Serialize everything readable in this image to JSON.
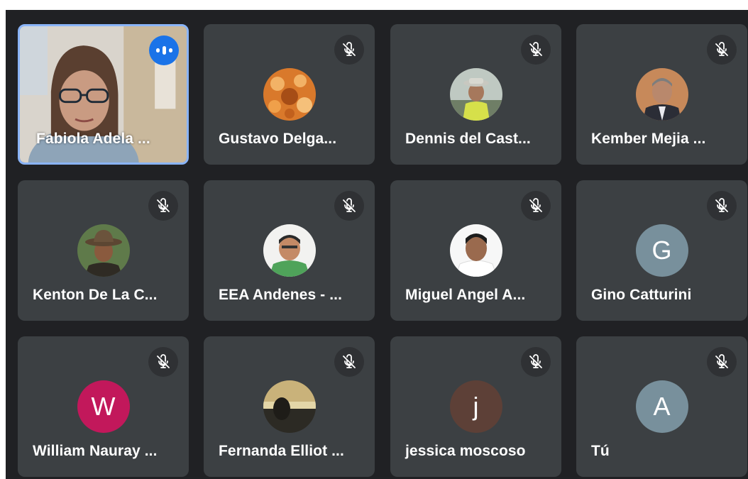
{
  "participants": [
    {
      "name": "Fabiola Adela ...",
      "muted": false,
      "speaking": true,
      "avatar": "video-feed"
    },
    {
      "name": "Gustavo Delga...",
      "muted": true,
      "avatar": "photo-orange-pattern"
    },
    {
      "name": "Dennis del Cast...",
      "muted": true,
      "avatar": "photo-person-hat-vest"
    },
    {
      "name": "Kember Mejia ...",
      "muted": true,
      "avatar": "photo-person-suit"
    },
    {
      "name": "Kenton De La C...",
      "muted": true,
      "avatar": "photo-person-hat"
    },
    {
      "name": "EEA Andenes - ...",
      "muted": true,
      "avatar": "photo-person-green-shirt"
    },
    {
      "name": "Miguel Angel A...",
      "muted": true,
      "avatar": "photo-person-white-shirt"
    },
    {
      "name": "Gino Catturini",
      "muted": true,
      "avatar_letter": "G",
      "avatar_color": "#78909c"
    },
    {
      "name": "William Nauray ...",
      "muted": true,
      "avatar_letter": "W",
      "avatar_color": "#c2185b"
    },
    {
      "name": "Fernanda Elliot ...",
      "muted": true,
      "avatar": "photo-sunset"
    },
    {
      "name": "jessica moscoso",
      "muted": true,
      "avatar_letter": "j",
      "avatar_color": "#5d4037"
    },
    {
      "name": "Tú",
      "muted": true,
      "avatar_letter": "A",
      "avatar_color": "#78909c"
    }
  ],
  "colors": {
    "background": "#202124",
    "tile": "#3c4043",
    "speaking_border": "#8ab4f8",
    "speaking_indicator": "#1a73e8"
  }
}
